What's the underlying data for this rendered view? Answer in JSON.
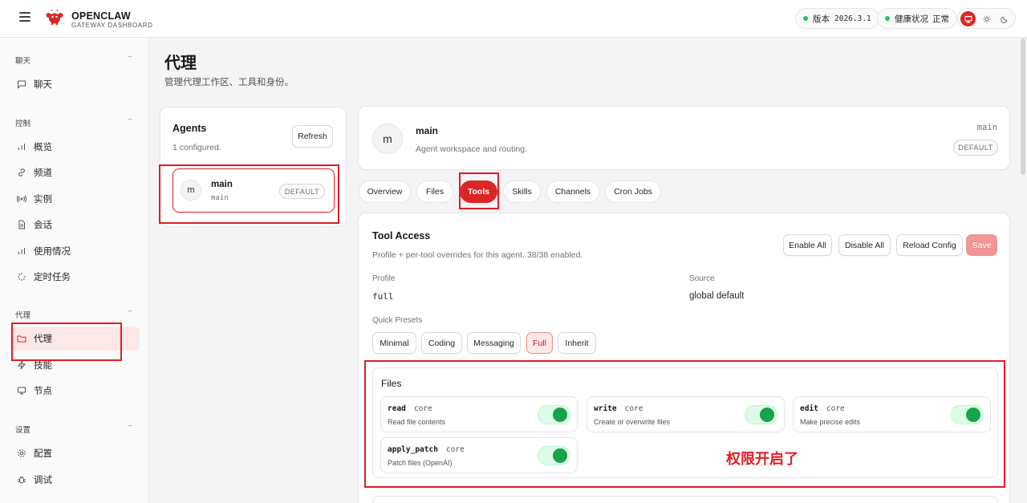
{
  "header": {
    "brand_name": "OPENCLAW",
    "brand_sub": "GATEWAY DASHBOARD",
    "version_label": "版本",
    "version_value": "2026.3.1",
    "health_label": "健康状况",
    "health_value": "正常",
    "accent_color": "#dc2626",
    "status_color": "#22c55e"
  },
  "sidebar": {
    "sections": [
      {
        "label": "聊天",
        "items": [
          {
            "label": "聊天",
            "icon": "message-icon"
          }
        ]
      },
      {
        "label": "控制",
        "items": [
          {
            "label": "概览",
            "icon": "bar-chart-icon"
          },
          {
            "label": "频道",
            "icon": "link-icon"
          },
          {
            "label": "实例",
            "icon": "radio-icon"
          },
          {
            "label": "会话",
            "icon": "file-icon"
          },
          {
            "label": "使用情况",
            "icon": "bar-chart-icon"
          },
          {
            "label": "定时任务",
            "icon": "loader-icon"
          }
        ]
      },
      {
        "label": "代理",
        "items": [
          {
            "label": "代理",
            "icon": "folder-icon",
            "active": true
          },
          {
            "label": "技能",
            "icon": "zap-icon"
          },
          {
            "label": "节点",
            "icon": "monitor-icon"
          }
        ]
      },
      {
        "label": "设置",
        "items": [
          {
            "label": "配置",
            "icon": "gear-icon"
          },
          {
            "label": "调试",
            "icon": "bug-icon"
          }
        ]
      }
    ],
    "collapse_symbol": "−"
  },
  "page": {
    "title": "代理",
    "subtitle": "管理代理工作区、工具和身份。"
  },
  "agents_panel": {
    "title": "Agents",
    "count": "1 configured.",
    "refresh_label": "Refresh",
    "agent": {
      "avatar": "m",
      "name": "main",
      "id": "main",
      "badge": "DEFAULT"
    }
  },
  "agent_header": {
    "avatar": "m",
    "name": "main",
    "subtitle": "Agent workspace and routing.",
    "id": "main",
    "badge": "DEFAULT"
  },
  "tabs": [
    "Overview",
    "Files",
    "Tools",
    "Skills",
    "Channels",
    "Cron Jobs"
  ],
  "active_tab": "Tools",
  "tool_access": {
    "title": "Tool Access",
    "subtitle": "Profile + per-tool overrides for this agent. 38/38 enabled.",
    "enable_all": "Enable All",
    "disable_all": "Disable All",
    "reload": "Reload Config",
    "save": "Save",
    "profile_label": "Profile",
    "profile_value": "full",
    "source_label": "Source",
    "source_value": "global default",
    "presets_label": "Quick Presets",
    "presets": [
      "Minimal",
      "Coding",
      "Messaging",
      "Full",
      "Inherit"
    ],
    "active_preset": "Full"
  },
  "files_group": {
    "title": "Files",
    "tools": [
      {
        "name": "read",
        "tag": "core",
        "desc": "Read file contents",
        "enabled": true
      },
      {
        "name": "write",
        "tag": "core",
        "desc": "Create or overwrite files",
        "enabled": true
      },
      {
        "name": "edit",
        "tag": "core",
        "desc": "Make precise edits",
        "enabled": true
      },
      {
        "name": "apply_patch",
        "tag": "core",
        "desc": "Patch files (OpenAI)",
        "enabled": true
      }
    ]
  },
  "annotation": {
    "text": "权限开启了",
    "color": "#e11d24"
  }
}
